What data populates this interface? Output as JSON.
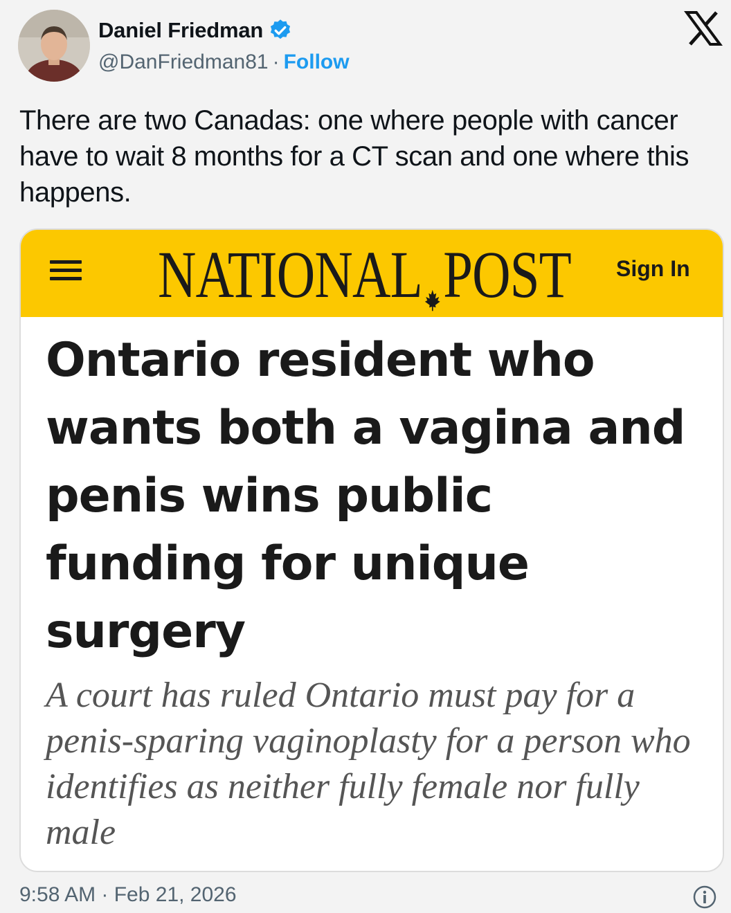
{
  "author": {
    "display_name": "Daniel Friedman",
    "handle": "@DanFriedman81",
    "separator": "·",
    "follow_label": "Follow",
    "verified": true,
    "avatar_icon": "profile-photo"
  },
  "platform_icon": "x-logo-icon",
  "tweet": {
    "text": "There are two Canadas: one where people with cancer have to wait 8 months for a CT scan and one where this happens.",
    "timestamp": "9:58 AM · Feb 21, 2026"
  },
  "card": {
    "publication_left": "NATIONAL",
    "publication_right": "POST",
    "sign_in_label": "Sign In",
    "headline": "Ontario resident who wants both a vagina and penis wins public funding for unique surgery",
    "deck": "A court has ruled Ontario must pay for a penis-sparing vaginoplasty for a person who identifies as neither fully female nor fully male"
  },
  "colors": {
    "brand_yellow": "#fcc800",
    "follow_blue": "#1d9bf0",
    "verified_blue": "#1d9bf0",
    "muted_gray": "#536471"
  }
}
